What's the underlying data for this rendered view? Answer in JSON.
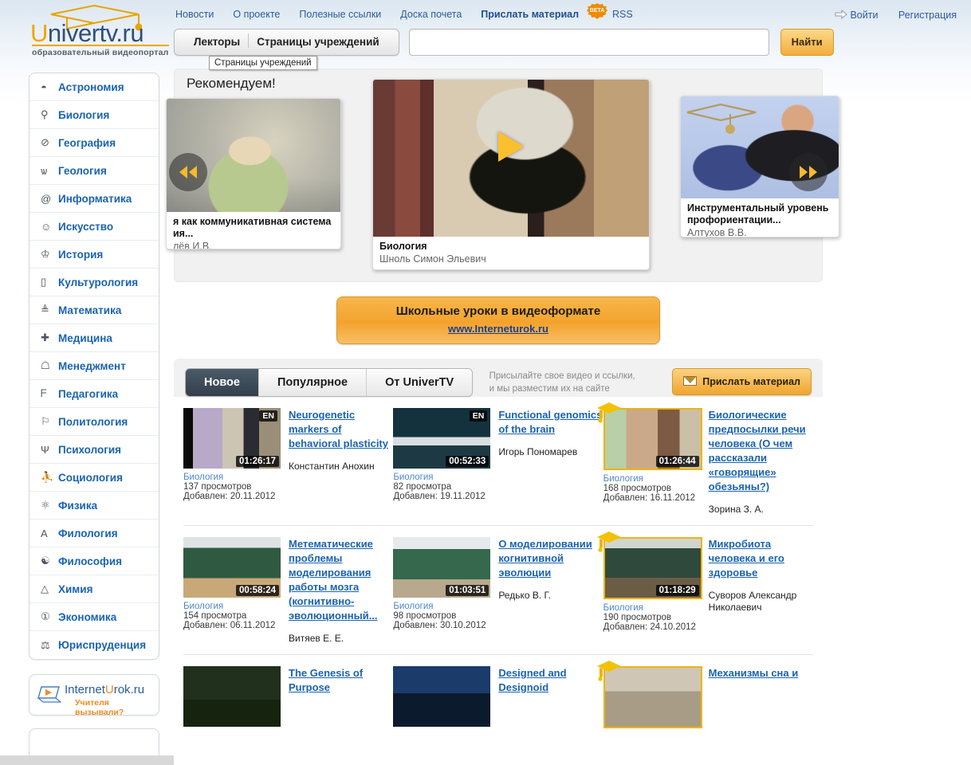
{
  "site": {
    "logo_word": "Univertv.ru",
    "logo_u": "U",
    "logo_rest": "nivertv",
    "logo_dot_ru": ".ru",
    "logo_sub": "образовательный видеопортал"
  },
  "topnav": {
    "items": [
      {
        "label": "Новости",
        "name": "nav-news"
      },
      {
        "label": "О проекте",
        "name": "nav-about"
      },
      {
        "label": "Полезные ссылки",
        "name": "nav-links"
      },
      {
        "label": "Доска почета",
        "name": "nav-honor"
      }
    ],
    "send_material": "Прислать материал",
    "beta": "BETA",
    "rss": "RSS"
  },
  "userlinks": {
    "login": "Войти",
    "register": "Регистрация"
  },
  "search": {
    "tab_lecturers": "Лекторы",
    "tab_institutions": "Страницы учреждений",
    "value": "",
    "placeholder": "",
    "button": "Найти",
    "tooltip": "Страницы учреждений"
  },
  "sidebar": {
    "items": [
      {
        "label": "Астрономия",
        "icon": "saturn-icon",
        "glyph": "◓"
      },
      {
        "label": "Биология",
        "icon": "dna-icon",
        "glyph": "⚲"
      },
      {
        "label": "География",
        "icon": "compass-icon",
        "glyph": "⊘"
      },
      {
        "label": "Геология",
        "icon": "crystal-icon",
        "glyph": "ѡ"
      },
      {
        "label": "Информатика",
        "icon": "at-icon",
        "glyph": "@"
      },
      {
        "label": "Искусство",
        "icon": "mask-icon",
        "glyph": "☺"
      },
      {
        "label": "История",
        "icon": "column-icon",
        "glyph": "♔"
      },
      {
        "label": "Культурология",
        "icon": "book-icon",
        "glyph": "▯"
      },
      {
        "label": "Математика",
        "icon": "abacus-icon",
        "glyph": "≜"
      },
      {
        "label": "Медицина",
        "icon": "cross-icon",
        "glyph": "✚"
      },
      {
        "label": "Менеджмент",
        "icon": "person-icon",
        "glyph": "☖"
      },
      {
        "label": "Педагогика",
        "icon": "pointer-icon",
        "glyph": "ᖴ"
      },
      {
        "label": "Политология",
        "icon": "flag-icon",
        "glyph": "⚐"
      },
      {
        "label": "Психология",
        "icon": "psi-icon",
        "glyph": "Ψ"
      },
      {
        "label": "Социология",
        "icon": "group-icon",
        "glyph": "⛹"
      },
      {
        "label": "Физика",
        "icon": "atom-icon",
        "glyph": "⚛"
      },
      {
        "label": "Филология",
        "icon": "letter-a-icon",
        "glyph": "A"
      },
      {
        "label": "Философия",
        "icon": "yinyang-icon",
        "glyph": "☯"
      },
      {
        "label": "Химия",
        "icon": "flask-icon",
        "glyph": "△"
      },
      {
        "label": "Экономика",
        "icon": "coin-icon",
        "glyph": "①"
      },
      {
        "label": "Юриспруденция",
        "icon": "scales-icon",
        "glyph": "⚖"
      }
    ],
    "banner": {
      "title_internet": "Internet",
      "title_u": "U",
      "title_rok": "rok",
      "title_ru": ".ru",
      "subtitle": "Учителя вызывали?"
    }
  },
  "recommend": {
    "heading": "Рекомендуем!",
    "prev_icon": "prev-arrows-icon",
    "next_icon": "next-arrows-icon",
    "left_card": {
      "title": "я как коммуникативная система",
      "title2": "ия...",
      "author": "лёв И.В."
    },
    "center_card": {
      "category": "Биология",
      "author": "Шноль Симон Эльевич",
      "play_icon": "play-icon"
    },
    "right_card": {
      "title": "Инструментальный уровень",
      "title2": "профориентации...",
      "author": "Алтухов В.В."
    }
  },
  "promo": {
    "title": "Школьные уроки в видеоформате",
    "link": "www.Interneturok.ru"
  },
  "tabs": {
    "items": [
      {
        "label": "Новое",
        "active": true
      },
      {
        "label": "Популярное",
        "active": false
      },
      {
        "label": "От UniverTV",
        "active": false
      }
    ],
    "note_line1": "Присылайте свое видео и ссылки,",
    "note_line2": "и мы разместим их на сайте",
    "send_button": "Прислать материал"
  },
  "videos": [
    {
      "title": "Neurogenetic markers of behavioral plasticity",
      "author": "Константин Анохин",
      "category": "Биология",
      "views": "137 просмотров",
      "date": "Добавлен: 20.11.2012",
      "duration": "01:26:17",
      "lang_badge": "EN",
      "gold": false,
      "cap": false
    },
    {
      "title": "Functional genomics of the brain",
      "author": "Игорь Пономарев",
      "category": "Биология",
      "views": "82 просмотра",
      "date": "Добавлен: 19.11.2012",
      "duration": "00:52:33",
      "lang_badge": "EN",
      "gold": false,
      "cap": false
    },
    {
      "title": "Биологические предпосылки речи человека (О чем рассказали «говорящие» обезьяны?)",
      "author": "Зорина З. А.",
      "category": "Биология",
      "views": "168 просмотров",
      "date": "Добавлен: 16.11.2012",
      "duration": "01:26:44",
      "lang_badge": "",
      "gold": true,
      "cap": true
    },
    {
      "title": "Метематические проблемы моделирования работы мозга (когнитивно-эволюционный...",
      "author": "Витяев Е. Е.",
      "category": "Биология",
      "views": "154 просмотра",
      "date": "Добавлен: 06.11.2012",
      "duration": "00:58:24",
      "lang_badge": "",
      "gold": false,
      "cap": false
    },
    {
      "title": "О моделировании когнитивной эволюции",
      "author": "Редько В. Г.",
      "category": "Биология",
      "views": "98 просмотров",
      "date": "Добавлен: 30.10.2012",
      "duration": "01:03:51",
      "lang_badge": "",
      "gold": false,
      "cap": false
    },
    {
      "title": "Микробиота человека и его здоровье",
      "author": "Суворов Александр Николаевич",
      "category": "Биология",
      "views": "190 просмотров",
      "date": "Добавлен: 24.10.2012",
      "duration": "01:18:29",
      "lang_badge": "",
      "gold": true,
      "cap": true
    },
    {
      "title": "The Genesis of Purpose",
      "author": "",
      "category": "",
      "views": "",
      "date": "",
      "duration": "",
      "lang_badge": "",
      "gold": false,
      "cap": false
    },
    {
      "title": "Designed and Designoid",
      "author": "",
      "category": "",
      "views": "",
      "date": "",
      "duration": "",
      "lang_badge": "",
      "gold": false,
      "cap": false
    },
    {
      "title": "Механизмы сна и",
      "author": "",
      "category": "",
      "views": "",
      "date": "",
      "duration": "",
      "lang_badge": "",
      "gold": true,
      "cap": true
    }
  ],
  "colors": {
    "brand_orange": "#f0a500",
    "link_blue": "#1a63b0",
    "nav_blue": "#2a5d9e",
    "tab_active_bg": "#3b4956"
  }
}
